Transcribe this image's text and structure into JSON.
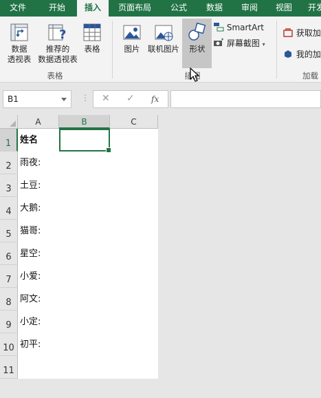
{
  "tabs": [
    "文件",
    "开始",
    "插入",
    "页面布局",
    "公式",
    "数据",
    "审阅",
    "视图",
    "开发"
  ],
  "active_tab": "插入",
  "ribbon": {
    "pivot_label_1": "数据",
    "pivot_label_2": "透视表",
    "rec_pivot_label_1": "推荐的",
    "rec_pivot_label_2": "数据透视表",
    "table_label": "表格",
    "group_tables": "表格",
    "picture_label": "图片",
    "online_picture_label": "联机图片",
    "shapes_label": "形状",
    "smartart_label": "SmartArt",
    "screenshot_label": "屏幕截图",
    "group_illustrations": "插图",
    "get_addins_label": "获取加",
    "my_addins_label": "我的加",
    "group_addins": "加载"
  },
  "formula_bar": {
    "name_box": "B1",
    "cancel_symbol": "✕",
    "enter_symbol": "✓",
    "fx_symbol": "fx",
    "formula": ""
  },
  "sheet": {
    "columns": [
      "A",
      "B",
      "C"
    ],
    "selected_column": "B",
    "rows": [
      "1",
      "2",
      "3",
      "4",
      "5",
      "6",
      "7",
      "8",
      "9",
      "10",
      "11"
    ],
    "selected_row": "1",
    "col_a": [
      "姓名",
      "雨夜:",
      "土豆:",
      "大鹅:",
      "猫哥:",
      "星空:",
      "小爱:",
      "阿文:",
      "小定:",
      "初平:",
      ""
    ]
  },
  "colors": {
    "accent": "#217346",
    "ribbon_bg": "#f3f3f3",
    "app_bg": "#e6e6e6"
  }
}
